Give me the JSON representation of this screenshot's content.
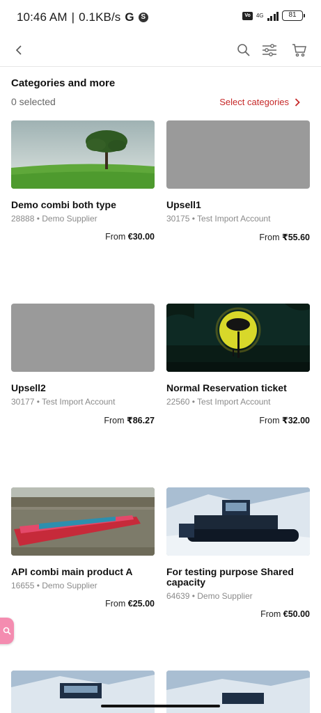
{
  "status_bar": {
    "time": "10:46 AM",
    "speed": "0.1KB/s",
    "g_glyph": "G",
    "volte": "VoLTE",
    "network": "4G",
    "battery": "81"
  },
  "app_bar": {
    "icons": [
      "back-arrow-icon",
      "search-icon",
      "filter-sliders-icon",
      "cart-icon"
    ]
  },
  "section": {
    "title": "Categories and more",
    "selected_count": "0 selected",
    "select_categories_label": "Select categories"
  },
  "products": [
    {
      "name": "Demo combi both type",
      "id": "28888",
      "supplier": "Demo Supplier",
      "price_prefix": "From",
      "price": "€30.00",
      "image": "tree-field"
    },
    {
      "name": "Upsell1",
      "id": "30175",
      "supplier": "Test Import Account",
      "price_prefix": "From",
      "price": "₹55.60",
      "image": "placeholder"
    },
    {
      "name": "Upsell2",
      "id": "30177",
      "supplier": "Test Import Account",
      "price_prefix": "From",
      "price": "₹86.27",
      "image": "placeholder"
    },
    {
      "name": "Normal Reservation ticket",
      "id": "22560",
      "supplier": "Test Import Account",
      "price_prefix": "From",
      "price": "₹32.00",
      "image": "moon-tree"
    },
    {
      "name": "API combi main product A",
      "id": "16655",
      "supplier": "Demo Supplier",
      "price_prefix": "From",
      "price": "€25.00",
      "image": "canal-boat"
    },
    {
      "name": "For testing purpose Shared capacity",
      "id": "64639",
      "supplier": "Demo Supplier",
      "price_prefix": "From",
      "price": "€50.00",
      "image": "snow-groomer"
    },
    {
      "name": "",
      "id": "",
      "supplier": "",
      "price_prefix": "",
      "price": "",
      "image": "snow-groomer"
    },
    {
      "name": "",
      "id": "",
      "supplier": "",
      "price_prefix": "",
      "price": "",
      "image": "snow-groomer"
    }
  ],
  "separator": "•",
  "colors": {
    "accent_red": "#c62828",
    "placeholder_gray": "#9a9a9a",
    "fab_pink": "#f48cb0"
  }
}
